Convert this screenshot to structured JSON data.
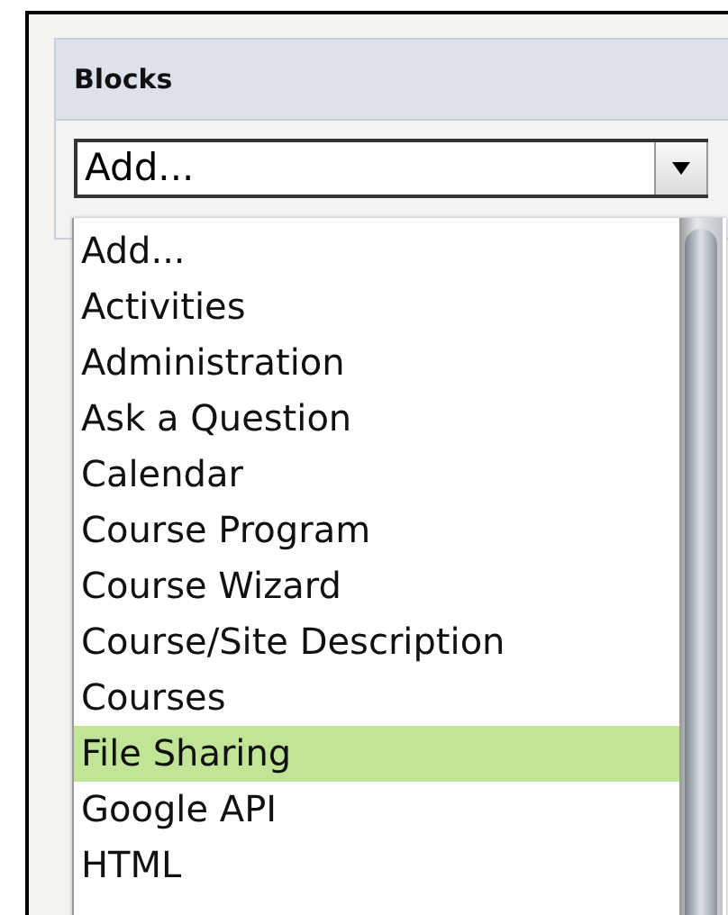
{
  "panel": {
    "title": "Blocks"
  },
  "select": {
    "value": "Add..."
  },
  "options": [
    {
      "label": "Add...",
      "selected": false
    },
    {
      "label": "Activities",
      "selected": false
    },
    {
      "label": "Administration",
      "selected": false
    },
    {
      "label": "Ask a Question",
      "selected": false
    },
    {
      "label": "Calendar",
      "selected": false
    },
    {
      "label": "Course Program",
      "selected": false
    },
    {
      "label": "Course Wizard",
      "selected": false
    },
    {
      "label": "Course/Site Description",
      "selected": false
    },
    {
      "label": "Courses",
      "selected": false
    },
    {
      "label": "File Sharing",
      "selected": true
    },
    {
      "label": "Google API",
      "selected": false
    },
    {
      "label": "HTML",
      "selected": false
    }
  ]
}
